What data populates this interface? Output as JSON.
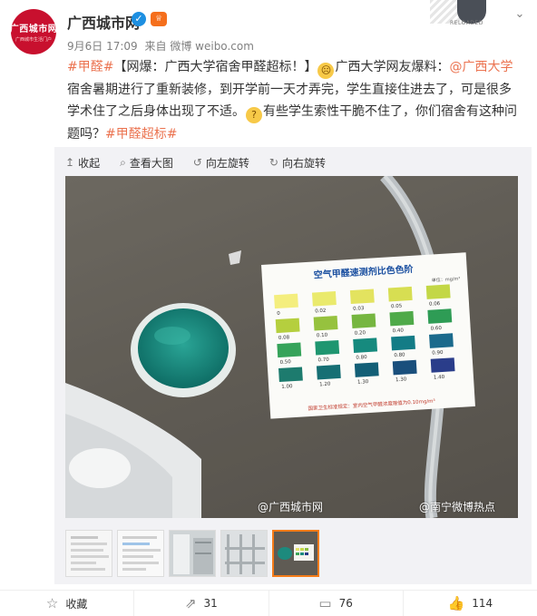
{
  "author": {
    "name": "广西城市网",
    "avatar_text": "广西城市网",
    "avatar_subtext": "广西城市生活门户"
  },
  "meta": {
    "time": "9月6日 17:09",
    "source_prefix": "来自",
    "source": "微博 weibo.com"
  },
  "deco_badge_text": "RELOADED",
  "post": {
    "hashtag_open": "#甲醛#",
    "text_1": "【网爆：广西大学宿舍甲醛超标！】",
    "text_2": "广西大学网友爆料：",
    "mention": "@广西大学",
    "text_3": "宿舍暑期进行了重新装修，到开学前一天才弄完，学生直接住进去了，可是很多学术住了之后身体出现了不适。",
    "text_4": "有些学生索性干脆不住了，你们宿舍有这种问题吗？",
    "hashtag_close": "#甲醛超标#"
  },
  "toolbar": {
    "collapse": "收起",
    "view_large": "查看大图",
    "rotate_left": "向左旋转",
    "rotate_right": "向右旋转"
  },
  "photo": {
    "card_title": "空气甲醛速测剂比色色阶",
    "card_unit": "单位：mg/m³",
    "swatches": [
      {
        "value": "0",
        "color": "#f4ee7e"
      },
      {
        "value": "0.02",
        "color": "#eaea6c"
      },
      {
        "value": "0.03",
        "color": "#e3e35f"
      },
      {
        "value": "0.05",
        "color": "#d7de52"
      },
      {
        "value": "0.06",
        "color": "#c3d746"
      },
      {
        "value": "0.08",
        "color": "#b5cf3e"
      },
      {
        "value": "0.10",
        "color": "#96c23e"
      },
      {
        "value": "0.20",
        "color": "#76b640"
      },
      {
        "value": "0.40",
        "color": "#4faa49"
      },
      {
        "value": "0.60",
        "color": "#2e9c55"
      },
      {
        "value": "0.50",
        "color": "#36a35a"
      },
      {
        "value": "0.70",
        "color": "#1f9670"
      },
      {
        "value": "0.80",
        "color": "#168a7e"
      },
      {
        "value": "0.80",
        "color": "#137c86"
      },
      {
        "value": "0.90",
        "color": "#1b6a8c"
      },
      {
        "value": "1.00",
        "color": "#1d7b6e"
      },
      {
        "value": "1.20",
        "color": "#166f74"
      },
      {
        "value": "1.30",
        "color": "#135f76"
      },
      {
        "value": "1.30",
        "color": "#1a4f7c"
      },
      {
        "value": "1.40",
        "color": "#2a3d8a"
      }
    ],
    "card_footer": "国家卫生标准规定：室内空气甲醛浓度限值为0.10mg/m³",
    "watermark_left": "@广西城市网",
    "watermark_right": "@南宁微博热点"
  },
  "actions": {
    "favorite": "收藏",
    "repost_count": "31",
    "comment_count": "76",
    "like_count": "114"
  }
}
